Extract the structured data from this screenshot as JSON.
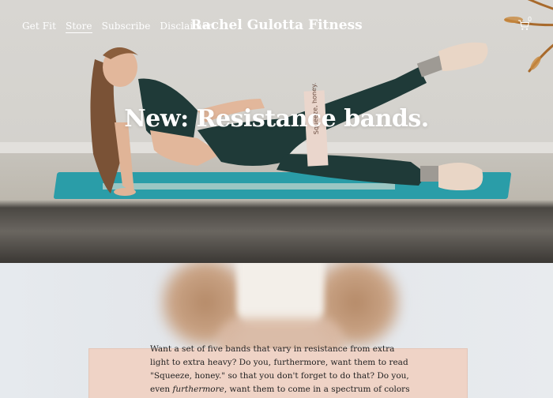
{
  "nav": {
    "items": [
      {
        "label": "Get Fit",
        "active": false
      },
      {
        "label": "Store",
        "active": true
      },
      {
        "label": "Subscribe",
        "active": false
      },
      {
        "label": "Disclaimer",
        "active": false
      }
    ]
  },
  "site": {
    "title": "Rachel Gulotta Fitness"
  },
  "cart": {
    "count": "0",
    "icon": "cart-icon"
  },
  "hero": {
    "headline": "New: Resistance bands.",
    "band_text": "Squeeze, honey."
  },
  "body": {
    "text_before": "Want a set of five bands that vary in resistance from extra light to extra heavy? Do you, furthermore, want them to read \"Squeeze, honey.\" so that you don't forget to do that? Do you, even ",
    "emphasis": "furthermore",
    "text_after": ", want them to come in a spectrum of colors"
  },
  "colors": {
    "text_white": "#ffffff",
    "body_text": "#222222",
    "mat": "#2a9da8",
    "outfit": "#1f3a38"
  }
}
